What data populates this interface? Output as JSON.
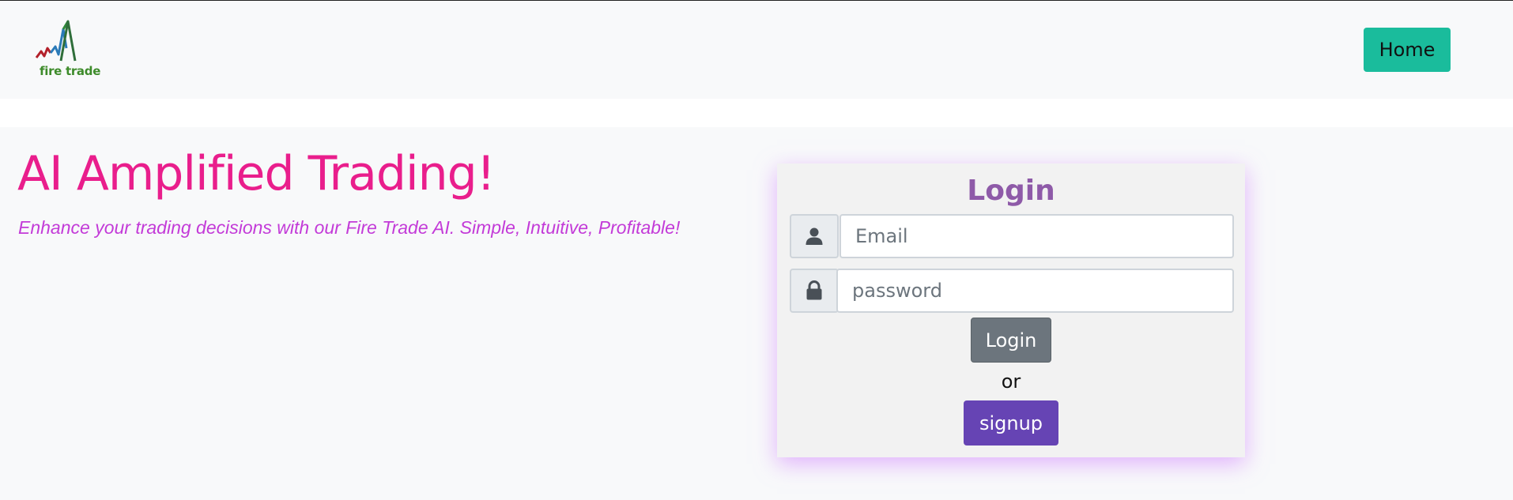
{
  "navbar": {
    "logo_text": "fire trade",
    "home_label": "Home",
    "home_color": "#1abc9c"
  },
  "hero": {
    "title": "AI Amplified Trading!",
    "subtitle": "Enhance your trading decisions with our Fire Trade AI. Simple, Intuitive, Profitable!",
    "title_color": "#e91e8c",
    "subtitle_color": "#c33bd8"
  },
  "login_card": {
    "title": "Login",
    "email": {
      "icon": "user-icon",
      "value": "",
      "placeholder": "Email"
    },
    "password": {
      "icon": "lock-icon",
      "value": "",
      "placeholder": "password"
    },
    "login_button_label": "Login",
    "or_text": "or",
    "signup_button_label": "signup",
    "signup_color": "#6644b4",
    "shadow_color": "#cd78ff"
  }
}
